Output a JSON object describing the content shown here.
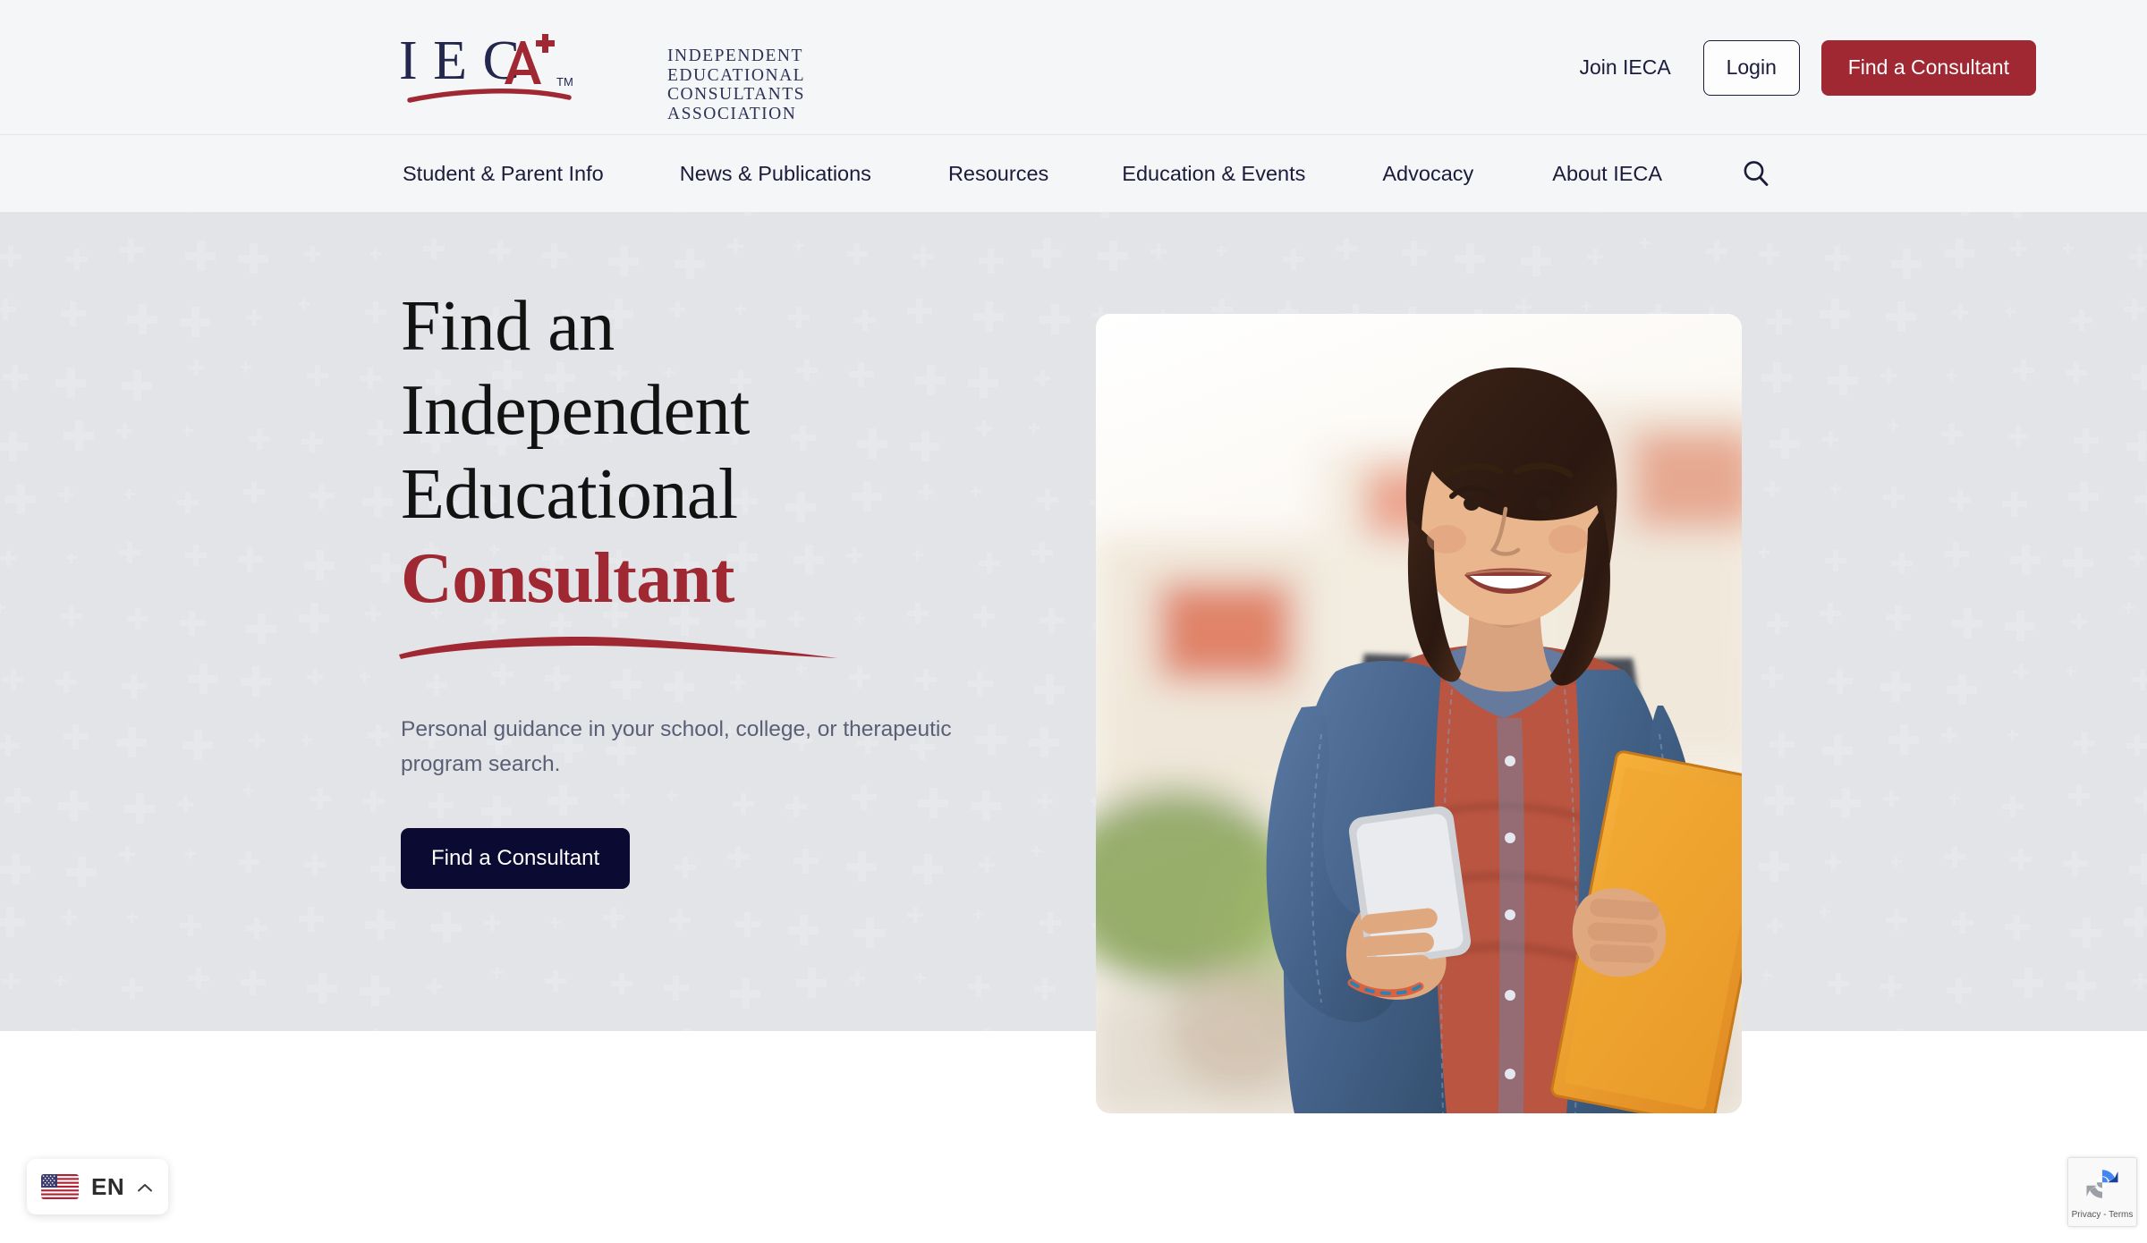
{
  "brand": {
    "acronym": "IECA",
    "name_lines": [
      "INDEPENDENT",
      "EDUCATIONAL",
      "CONSULTANTS",
      "ASSOCIATION"
    ],
    "trademark": "TM",
    "colors": {
      "red": "#a02833",
      "navy": "#0b0a33",
      "logo_navy": "#2c3157",
      "hero_bg": "#f5f6f8",
      "body_text": "#1b1b3a",
      "muted_text": "#5a5f75"
    }
  },
  "header": {
    "join_label": "Join IECA",
    "login_label": "Login",
    "cta_label": "Find a Consultant"
  },
  "nav": {
    "items": [
      {
        "label": "Student & Parent Info"
      },
      {
        "label": "News & Publications"
      },
      {
        "label": "Resources"
      },
      {
        "label": "Education & Events"
      },
      {
        "label": "Advocacy"
      },
      {
        "label": "About IECA"
      }
    ],
    "search_icon": "search-icon"
  },
  "hero": {
    "title_line1": "Find an",
    "title_line2": "Independent",
    "title_line3": "Educational",
    "title_accent": "Consultant",
    "subtitle": "Personal guidance in your school, college, or therapeutic program search.",
    "cta_label": "Find a Consultant",
    "image_alt": "smiling student holding phone and folder"
  },
  "language_switcher": {
    "code": "EN",
    "flag": "united-states-flag-icon",
    "chevron": "chevron-up-icon"
  },
  "recaptcha": {
    "label": "Privacy - Terms",
    "icon": "recaptcha-icon"
  }
}
